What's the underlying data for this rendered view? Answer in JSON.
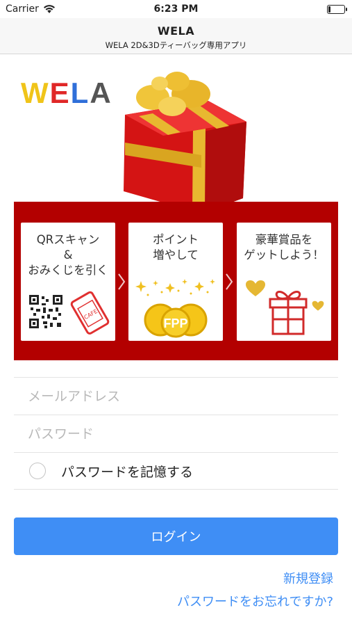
{
  "status_bar": {
    "carrier": "Carrier",
    "time": "6:23 PM"
  },
  "header": {
    "title": "WELA",
    "subtitle": "WELA 2D&3Dティーバッグ専用アプリ"
  },
  "logo": {
    "letters": [
      "W",
      "E",
      "L",
      "A"
    ],
    "colors": [
      "#f0c419",
      "#e02727",
      "#2f6fd9",
      "#555555"
    ]
  },
  "banner": {
    "color": "#b30000",
    "steps": [
      {
        "text": "QRスキャン\n&\nおみくじを引く",
        "art_text": "CAFE"
      },
      {
        "text": "ポイント\n増やして",
        "art_text": "FPP"
      },
      {
        "text": "豪華賞品を\nゲットしよう！"
      }
    ]
  },
  "form": {
    "email_placeholder": "メールアドレス",
    "password_placeholder": "パスワード",
    "remember_label": "パスワードを記憶する"
  },
  "actions": {
    "login_label": "ログイン",
    "register_label": "新規登録",
    "forgot_label": "パスワードをお忘れですか?"
  },
  "colors": {
    "accent": "#3f8ef5"
  }
}
